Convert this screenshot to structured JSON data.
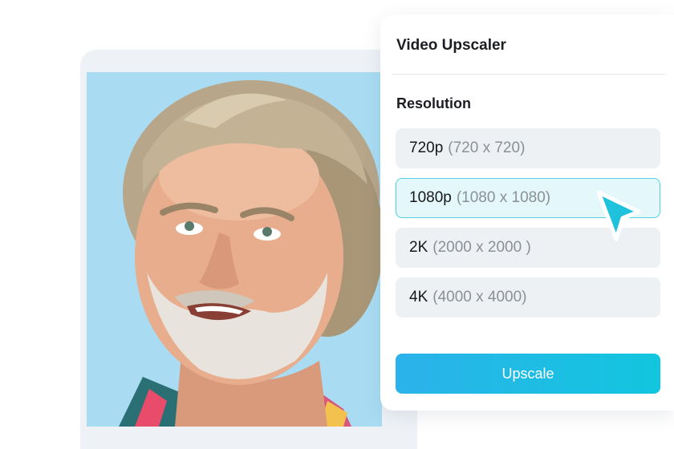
{
  "panel": {
    "title": "Video Upscaler",
    "section_label": "Resolution",
    "options": [
      {
        "label": "720p",
        "dims": "(720 x 720)",
        "selected": false
      },
      {
        "label": "1080p",
        "dims": "(1080 x 1080)",
        "selected": true
      },
      {
        "label": "2K",
        "dims": "(2000 x 2000 )",
        "selected": false
      },
      {
        "label": "4K",
        "dims": "(4000 x 4000)",
        "selected": false
      }
    ],
    "action_label": "Upscale"
  },
  "colors": {
    "accent": "#12c6de",
    "selected_border": "#4fd1e0",
    "selected_bg": "#e4f8fb",
    "option_bg": "#eef1f4",
    "photo_bg": "#a9dcf3"
  },
  "icons": {
    "cursor": "pointer-arrow-icon"
  }
}
